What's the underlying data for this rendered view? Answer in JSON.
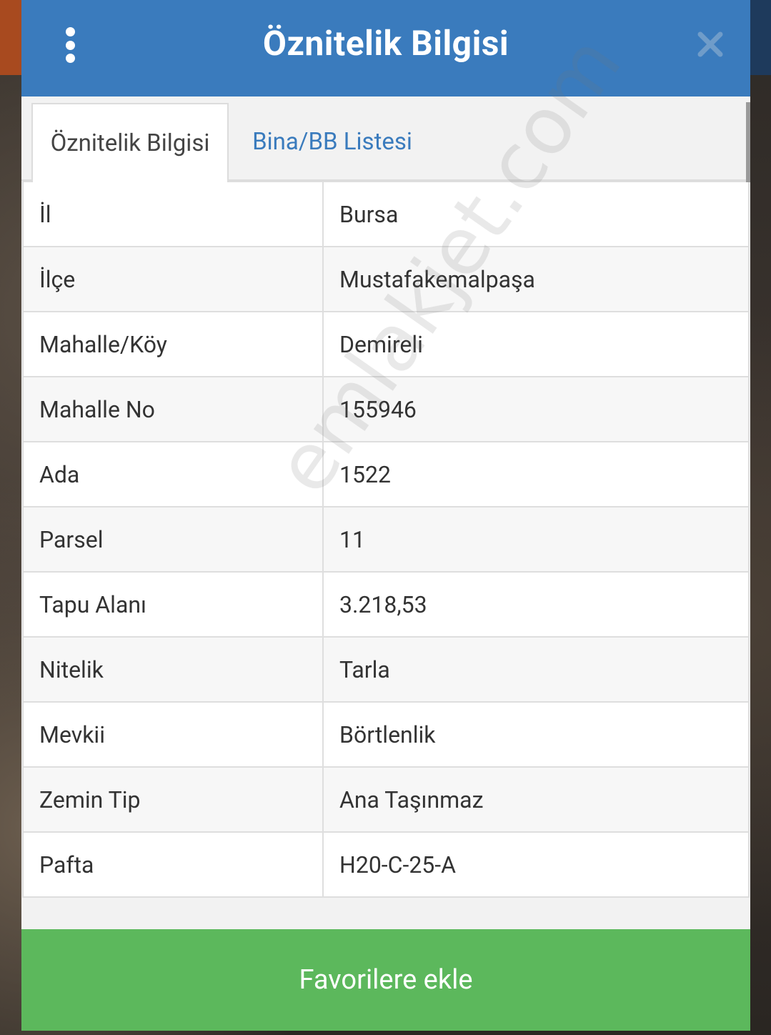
{
  "header": {
    "title": "Öznitelik Bilgisi",
    "menu_icon": "vertical-dots-icon",
    "close_icon": "close-icon"
  },
  "tabs": [
    {
      "label": "Öznitelik Bilgisi",
      "active": true
    },
    {
      "label": "Bina/BB Listesi",
      "active": false
    }
  ],
  "rows": [
    {
      "key": "İl",
      "value": "Bursa"
    },
    {
      "key": "İlçe",
      "value": "Mustafakemalpaşa"
    },
    {
      "key": "Mahalle/Köy",
      "value": "Demireli"
    },
    {
      "key": "Mahalle No",
      "value": "155946"
    },
    {
      "key": "Ada",
      "value": "1522"
    },
    {
      "key": "Parsel",
      "value": "11"
    },
    {
      "key": "Tapu Alanı",
      "value": "3.218,53"
    },
    {
      "key": "Nitelik",
      "value": "Tarla"
    },
    {
      "key": "Mevkii",
      "value": "Börtlenlik"
    },
    {
      "key": "Zemin Tip",
      "value": "Ana Taşınmaz"
    },
    {
      "key": "Pafta",
      "value": "H20-C-25-A"
    }
  ],
  "watermark": "emlakjet.com",
  "footer": {
    "favorite_label": "Favorilere ekle"
  },
  "colors": {
    "header": "#3a7bbd",
    "accent_green": "#5cb85c",
    "tab_link": "#3a7bbd"
  }
}
